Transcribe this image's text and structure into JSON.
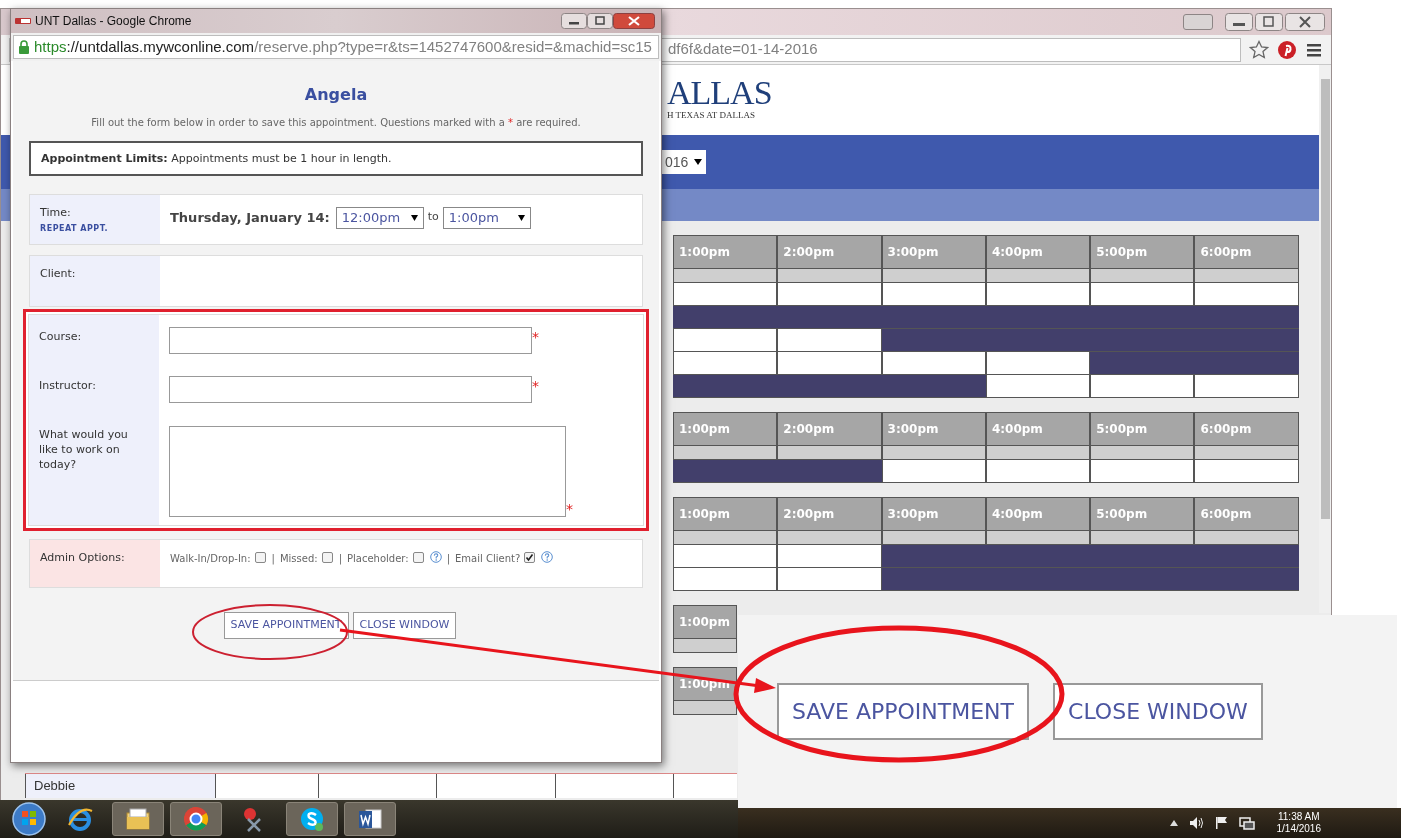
{
  "background_window": {
    "address_tail": "df6f&date=01-14-2016",
    "logo": "ALLAS",
    "logo_subtitle": "H TEXAS AT DALLAS",
    "date_select": "016"
  },
  "schedule": [
    {
      "times": [
        "1:00pm",
        "2:00pm",
        "3:00pm",
        "4:00pm",
        "5:00pm",
        "6:00pm"
      ],
      "rows": [
        {
          "booked": [
            false,
            false,
            false,
            false,
            false,
            false
          ]
        },
        {
          "booked": [
            true,
            true,
            true,
            true,
            true,
            true
          ]
        },
        {
          "booked": [
            false,
            false,
            true,
            true,
            true,
            true
          ]
        },
        {
          "booked": [
            false,
            false,
            false,
            false,
            true,
            true
          ]
        },
        {
          "booked": [
            true,
            true,
            true,
            false,
            false,
            false
          ]
        }
      ]
    },
    {
      "times": [
        "1:00pm",
        "2:00pm",
        "3:00pm",
        "4:00pm",
        "5:00pm",
        "6:00pm"
      ],
      "rows": [
        {
          "booked": [
            true,
            true,
            false,
            false,
            false,
            false
          ]
        }
      ]
    },
    {
      "times": [
        "1:00pm",
        "2:00pm",
        "3:00pm",
        "4:00pm",
        "5:00pm",
        "6:00pm"
      ],
      "rows": [
        {
          "booked": [
            false,
            false,
            true,
            true,
            true,
            true
          ]
        },
        {
          "booked": [
            false,
            false,
            true,
            true,
            true,
            true
          ]
        }
      ]
    },
    {
      "times": [
        "1:00pm"
      ]
    },
    {
      "times": [
        "1:00pm"
      ]
    }
  ],
  "name_rows": [
    {
      "name": "Debbie",
      "booked": [
        false,
        false,
        false,
        false,
        false
      ]
    }
  ],
  "popup": {
    "title": "UNT Dallas - Google Chrome",
    "url_scheme": "https",
    "url_host": "://untdallas.mywconline.com",
    "url_rest": "/reserve.php?type=r&ts=1452747600&resid=&machid=sc15"
  },
  "form": {
    "title": "Angela",
    "instructions": {
      "before": "Fill out the form below in order to save this appointment. Questions marked with a ",
      "mark": "*",
      "after": " are required."
    },
    "limits": "**Appointment Limits:** Appointments must be 1 hour in length.",
    "time": {
      "label": "Time:",
      "link": "REPEAT APPT.",
      "date": "Thursday, January 14:",
      "start": "12:00pm",
      "separator": "to",
      "end": "1:00pm"
    },
    "client": {
      "label": "Client:"
    },
    "questions": [
      {
        "label": "Course:",
        "kind": "text",
        "required_mark": "*"
      },
      {
        "label": "Instructor:",
        "kind": "text",
        "required_mark": "*"
      },
      {
        "label": "What would you like to work on today?",
        "kind": "textarea",
        "required_mark": "*"
      }
    ],
    "admin": {
      "label": "Admin Options:",
      "options": [
        {
          "label": "Walk-In/Drop-In:",
          "checked": false,
          "help": false
        },
        {
          "prefix": "|",
          "label": "Missed:",
          "checked": false,
          "help": false
        },
        {
          "prefix": "|",
          "label": "Placeholder:",
          "checked": false,
          "help": true
        },
        {
          "prefix": "|",
          "label": "Email Client?",
          "checked": true,
          "help": true
        }
      ]
    },
    "buttons": [
      "SAVE APPOINTMENT",
      "CLOSE WINDOW"
    ]
  },
  "callout": {
    "buttons": [
      "SAVE APPOINTMENT",
      "CLOSE WINDOW"
    ]
  },
  "taskbar": {
    "time": "11:38 AM",
    "date": "1/14/2016"
  }
}
